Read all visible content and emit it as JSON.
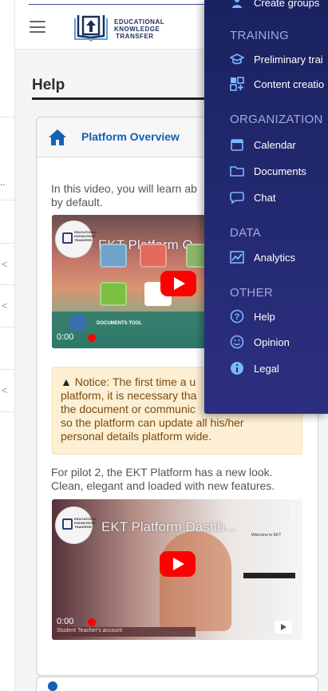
{
  "header": {
    "logo_line1": "EDUCATIONAL",
    "logo_line2": "KNOWLEDGE",
    "logo_line3": "TRANSFER"
  },
  "page": {
    "title": "Help"
  },
  "card": {
    "title": "Platform Overview",
    "intro": "In this video, you will learn ab",
    "intro_line2": "by default.",
    "notice_line1": "Notice: The first time a u",
    "notice_line2": "platform, it is necessary tha",
    "notice_line3": "the document or communic",
    "notice_line4": "so the platform can update all his/her",
    "notice_line5": "personal details platform wide.",
    "pilot_line1": "For pilot 2, the EKT Platform has a new look.",
    "pilot_line2": "Clean, elegant and loaded with new features."
  },
  "video1": {
    "title": "EKT Platform O",
    "time": "0:00",
    "caption": "DOCUMENTS TOOL"
  },
  "video2": {
    "title": "EKT Platform Dashb...",
    "time": "0:00",
    "caption": "Student Teacher's account",
    "welcome": "Welcome to EKT"
  },
  "drawer": {
    "top_item": "Create groups",
    "sections": [
      {
        "label": "TRAINING",
        "items": [
          "Preliminary trai",
          "Content creatio"
        ]
      },
      {
        "label": "ORGANIZATION",
        "items": [
          "Calendar",
          "Documents",
          "Chat"
        ]
      },
      {
        "label": "DATA",
        "items": [
          "Analytics"
        ]
      },
      {
        "label": "OTHER",
        "items": [
          "Help",
          "Opinion",
          "Legal"
        ]
      }
    ]
  },
  "colors": {
    "drawer_bg": "#242a72",
    "link_blue": "#1460b5",
    "notice_bg": "#fdefd3",
    "youtube_red": "#ff0000"
  }
}
